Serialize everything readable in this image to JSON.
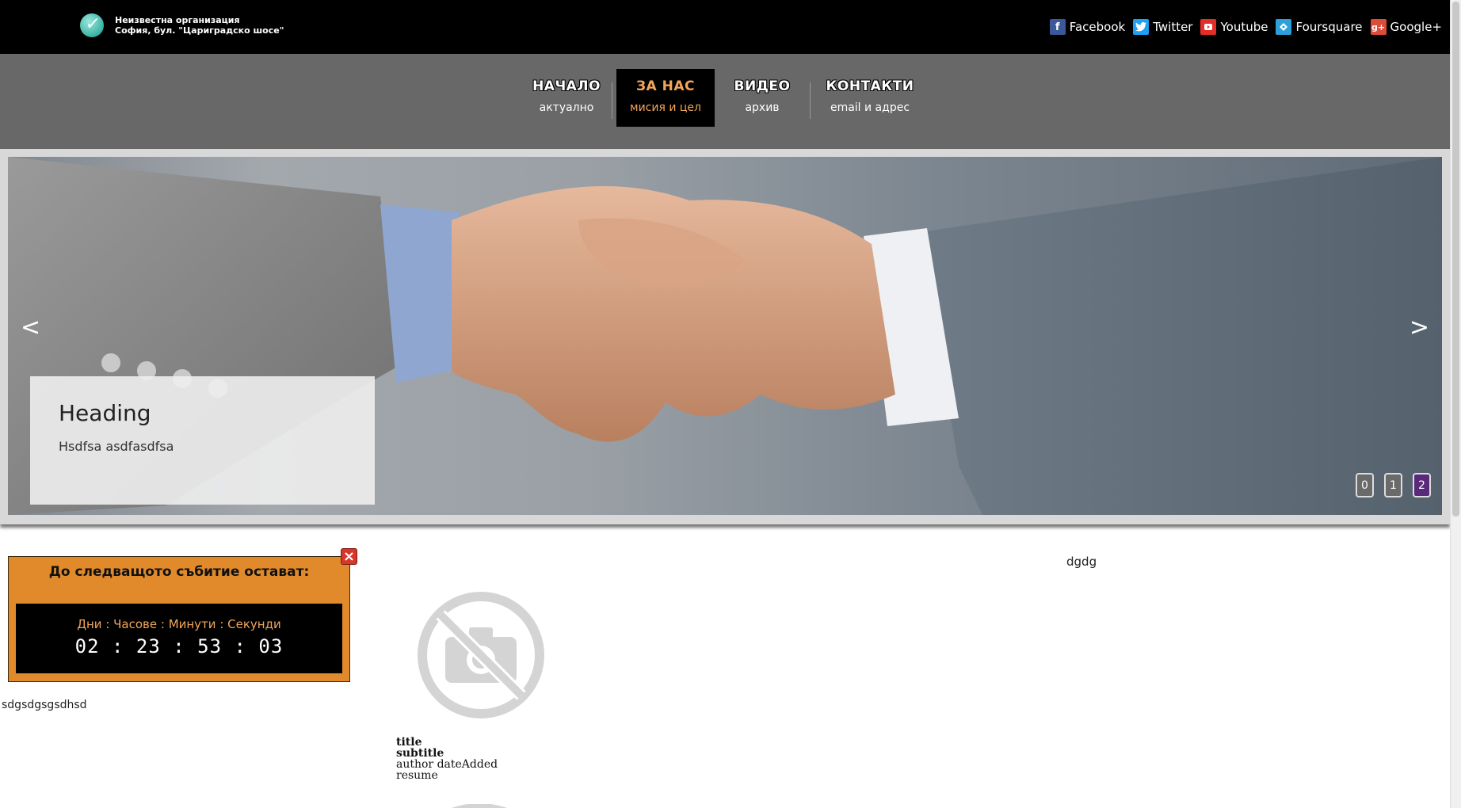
{
  "header": {
    "org_name": "Неизвестна организация",
    "org_address": "София, бул. \"Цариградско шосе\"",
    "logo_icon": "checkmark-icon",
    "social": [
      {
        "label": "Facebook",
        "icon": "facebook-icon",
        "color": "#3b5998"
      },
      {
        "label": "Twitter",
        "icon": "twitter-icon",
        "color": "#1da1f2"
      },
      {
        "label": "Youtube",
        "icon": "youtube-icon",
        "color": "#e52d27"
      },
      {
        "label": "Foursquare",
        "icon": "foursquare-icon",
        "color": "#2d9fd9"
      },
      {
        "label": "Google+",
        "icon": "googleplus-icon",
        "color": "#dd4b39"
      }
    ]
  },
  "nav": [
    {
      "title": "НАЧАЛО",
      "subtitle": "актуално",
      "active": false
    },
    {
      "title": "ЗА НАС",
      "subtitle": "мисия и цел",
      "active": true
    },
    {
      "title": "ВИДЕО",
      "subtitle": "архив",
      "active": false
    },
    {
      "title": "КОНТАКТИ",
      "subtitle": "email и адрес",
      "active": false
    }
  ],
  "slider": {
    "prev": "<",
    "next": ">",
    "caption_heading": "Heading",
    "caption_text": "Hsdfsa asdfasdfsa",
    "dots": [
      "0",
      "1",
      "2"
    ],
    "active_dot": 2
  },
  "countdown": {
    "title": "До следващото събитие остават:",
    "labels": "Дни : Часове : Минути : Секунди",
    "values": "02 : 23 : 53 : 03",
    "close": "x"
  },
  "content": {
    "left_text": "sdgsdgsgsdhsd",
    "right_text": "dgdg",
    "card": {
      "title": "title",
      "subtitle": "subtitle",
      "meta": "author dateAdded",
      "resume": "resume"
    }
  },
  "colors": {
    "accent": "#f2a65a",
    "countdown_bg": "#e08a2c",
    "nav_bg": "#686868",
    "active_dot": "#5a2a7a"
  }
}
